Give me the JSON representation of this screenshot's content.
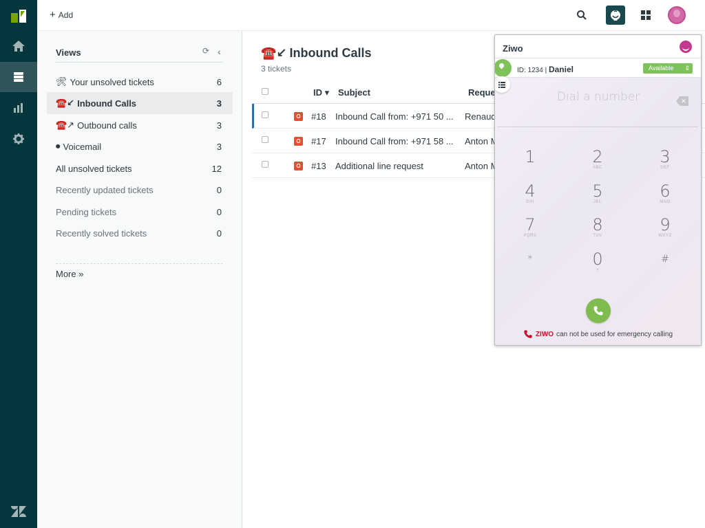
{
  "topbar": {
    "add_label": "Add",
    "add_glyph": "+"
  },
  "views": {
    "heading": "Views",
    "items": [
      {
        "icon": "🛠",
        "label": "Your unsolved tickets",
        "count": "6"
      },
      {
        "icon": "☎️↙",
        "label": "Inbound Calls",
        "count": "3"
      },
      {
        "icon": "☎️↗",
        "label": "Outbound calls",
        "count": "3"
      },
      {
        "icon": "⏺",
        "label": "Voicemail",
        "count": "3"
      },
      {
        "icon": "",
        "label": "All unsolved tickets",
        "count": "12"
      },
      {
        "icon": "",
        "label": "Recently updated tickets",
        "count": "0"
      },
      {
        "icon": "",
        "label": "Pending tickets",
        "count": "0"
      },
      {
        "icon": "",
        "label": "Recently solved tickets",
        "count": "0"
      }
    ],
    "more_label": "More »"
  },
  "main": {
    "title_icons": "☎️↙",
    "title": "Inbound Calls",
    "ticket_count": "3 tickets",
    "columns": {
      "id": "ID ▾",
      "subject": "Subject",
      "requester": "Reque"
    },
    "rows": [
      {
        "status": "O",
        "id": "#18",
        "subject": "Inbound Call from: +971 50 ...",
        "requester": "Renaud"
      },
      {
        "status": "O",
        "id": "#17",
        "subject": "Inbound Call from: +971 58 ...",
        "requester": "Anton M"
      },
      {
        "status": "O",
        "id": "#13",
        "subject": "Additional line request",
        "requester": "Anton M"
      }
    ]
  },
  "ziwo": {
    "title": "Ziwo",
    "id_text": "ID: 1234 | ",
    "agent_name": "Daniel",
    "status": "Available",
    "dial_placeholder": "Dial a number",
    "backspace_glyph": "✕",
    "keys": [
      {
        "digit": "1",
        "letters": ""
      },
      {
        "digit": "2",
        "letters": "ABC"
      },
      {
        "digit": "3",
        "letters": "DEF"
      },
      {
        "digit": "4",
        "letters": "GHI"
      },
      {
        "digit": "5",
        "letters": "JKL"
      },
      {
        "digit": "6",
        "letters": "MNO"
      },
      {
        "digit": "7",
        "letters": "PQRS"
      },
      {
        "digit": "8",
        "letters": "TUV"
      },
      {
        "digit": "9",
        "letters": "WXYZ"
      },
      {
        "digit": "*",
        "letters": ""
      },
      {
        "digit": "0",
        "letters": "+"
      },
      {
        "digit": "#",
        "letters": ""
      }
    ],
    "emergency_brand": "ZIWO",
    "emergency_text": "can not be used for emergency calling"
  },
  "colors": {
    "rail": "#03363d",
    "ziwo_green": "#7fc25c",
    "status_open": "#e34f32",
    "ziwo_brand": "#c23a8f"
  }
}
